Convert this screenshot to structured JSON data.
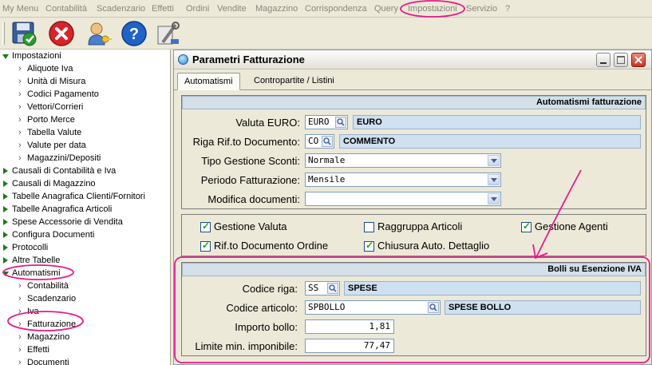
{
  "menubar": {
    "items": [
      "My Menu",
      "Contabilità",
      "Scadenzario",
      "Effetti",
      "Ordini",
      "Vendite",
      "Magazzino",
      "Corrispondenza",
      "Query",
      "Impostazioni",
      "Servizio",
      "?"
    ]
  },
  "toolbar": {
    "icons": [
      "save-icon",
      "close-icon",
      "user-key-icon",
      "help-icon",
      "tools-icon"
    ]
  },
  "tree": {
    "impostazioni": "Impostazioni",
    "sub_impostazioni": [
      "Aliquote Iva",
      "Unità di Misura",
      "Codici Pagamento",
      "Vettori/Corrieri",
      "Porto Merce",
      "Tabella Valute",
      "Valute per data",
      "Magazzini/Depositi"
    ],
    "roots": [
      "Causali di Contabilità e Iva",
      "Causali di Magazzino",
      "Tabelle Anagrafica Clienti/Fornitori",
      "Tabelle Anagrafica Articoli",
      "Spese Accessorie di Vendita",
      "Configura Documenti",
      "Protocolli",
      "Altre Tabelle"
    ],
    "automatismi": "Automatismi",
    "sub_automatismi": [
      "Contabilità",
      "Scadenzario",
      "Iva",
      "Fatturazione",
      "Magazzino",
      "Effetti",
      "Documenti"
    ]
  },
  "window": {
    "title": "Parametri Fatturazione",
    "tabs": [
      "Automatismi",
      "Contropartite / Listini"
    ],
    "section1_title": "Automatismi fatturazione",
    "valuta_label": "Valuta EURO:",
    "valuta_code": "EURO",
    "valuta_desc": "EURO",
    "riga_label": "Riga Rif.to Documento:",
    "riga_code": "CO",
    "riga_desc": "COMMENTO",
    "sconti_label": "Tipo Gestione Sconti:",
    "sconti_value": "Normale",
    "periodo_label": "Periodo Fatturazione:",
    "periodo_value": "Mensile",
    "modifica_label": "Modifica documenti:",
    "modifica_value": "",
    "checks": {
      "gestione_valuta": "Gestione Valuta",
      "raggruppa": "Raggruppa Articoli",
      "gestione_agenti": "Gestione Agenti",
      "rif_ordine": "Rif.to Documento Ordine",
      "chiusura": "Chiusura Auto. Dettaglio"
    },
    "section2_title": "Bolli su Esenzione IVA",
    "codice_riga_label": "Codice riga:",
    "codice_riga_code": "SS",
    "codice_riga_desc": "SPESE",
    "codice_articolo_label": "Codice articolo:",
    "codice_articolo_code": "SPBOLLO",
    "codice_articolo_desc": "SPESE BOLLO",
    "importo_label": "Importo bollo:",
    "importo_value": "1,81",
    "limite_label": "Limite min. imponibile:",
    "limite_value": "77,47"
  },
  "colors": {
    "annotation": "#e8198c",
    "section_header": "#d3dfe9",
    "desc_field": "#cfe0f0",
    "tree_arrow": "#1e7a1e"
  }
}
